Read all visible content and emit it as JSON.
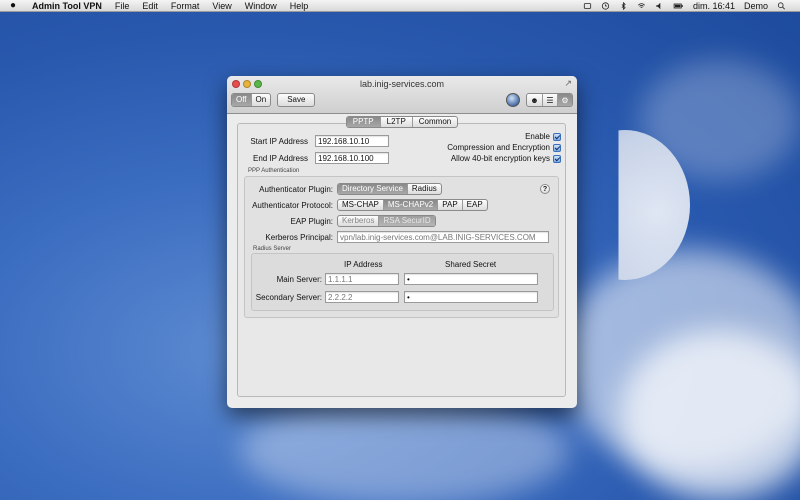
{
  "menubar": {
    "app_name": "Admin Tool VPN",
    "items": [
      "File",
      "Edit",
      "Format",
      "View",
      "Window",
      "Help"
    ],
    "clock": "dim. 16:41",
    "user": "Demo"
  },
  "window": {
    "title": "lab.inig-services.com",
    "toolbar": {
      "power": [
        "Off",
        "On"
      ],
      "power_selected": "Off",
      "save_label": "Save"
    },
    "tabs": [
      "PPTP",
      "L2TP",
      "Common"
    ],
    "selected_tab": "PPTP"
  },
  "pptp": {
    "start_ip_label": "Start IP Address",
    "start_ip": "192.168.10.10",
    "end_ip_label": "End IP Address",
    "end_ip": "192.168.10.100",
    "enable_label": "Enable",
    "compression_label": "Compression and Encryption",
    "allow40_label": "Allow 40-bit encryption keys",
    "enable_checked": true,
    "compression_checked": true,
    "allow40_checked": true
  },
  "ppp_auth": {
    "section_label": "PPP Authentication",
    "plugin_label": "Authenticator Plugin:",
    "plugin_options": [
      "Directory Service",
      "Radius"
    ],
    "plugin_selected": "Directory Service",
    "protocol_label": "Authenticator Protocol:",
    "protocol_options": [
      "MS-CHAP",
      "MS-CHAPv2",
      "PAP",
      "EAP"
    ],
    "protocol_selected": "MS-CHAPv2",
    "eap_label": "EAP Plugin:",
    "eap_options": [
      "Kerberos",
      "RSA SecurID"
    ],
    "eap_selected": "RSA SecurID",
    "kerberos_label": "Kerberos Principal:",
    "kerberos_value": "vpn/lab.inig-services.com@LAB.INIG-SERVICES.COM",
    "help": "?"
  },
  "radius": {
    "section_label": "Radius Server",
    "col_ip": "IP Address",
    "col_secret": "Shared Secret",
    "main_label": "Main Server:",
    "main_ip": "1.1.1.1",
    "main_secret": "•",
    "secondary_label": "Secondary Server:",
    "secondary_ip": "2.2.2.2",
    "secondary_secret": "•"
  }
}
